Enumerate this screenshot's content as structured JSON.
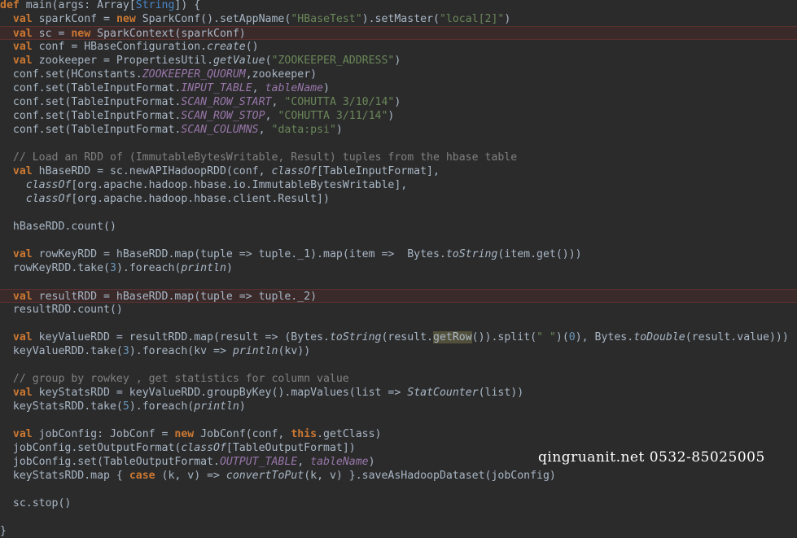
{
  "code_lines": [
    {
      "id": "l0",
      "indent": "",
      "parts": [
        [
          "kw",
          "def"
        ],
        [
          "p",
          " main(args: Array["
        ],
        [
          "ty",
          "String"
        ],
        [
          "p",
          "]) {"
        ]
      ]
    },
    {
      "id": "l1",
      "indent": "  ",
      "parts": [
        [
          "kw",
          "val"
        ],
        [
          "p",
          " sparkConf = "
        ],
        [
          "kw",
          "new"
        ],
        [
          "p",
          " SparkConf().setAppName("
        ],
        [
          "str",
          "\"HBaseTest\""
        ],
        [
          "p",
          ").setMaster("
        ],
        [
          "str",
          "\"local[2]\""
        ],
        [
          "p",
          ")"
        ]
      ]
    },
    {
      "id": "l2",
      "indent": "  ",
      "highlight": true,
      "parts": [
        [
          "kw",
          "val"
        ],
        [
          "p",
          " sc = "
        ],
        [
          "kw",
          "new"
        ],
        [
          "p",
          " SparkContext(sparkConf)"
        ]
      ]
    },
    {
      "id": "l3",
      "indent": "  ",
      "parts": [
        [
          "kw",
          "val"
        ],
        [
          "p",
          " conf = HBaseConfiguration."
        ],
        [
          "itm",
          "create"
        ],
        [
          "p",
          "()"
        ]
      ]
    },
    {
      "id": "l4",
      "indent": "  ",
      "parts": [
        [
          "kw",
          "val"
        ],
        [
          "p",
          " zookeeper = PropertiesUtil."
        ],
        [
          "itm",
          "getValue"
        ],
        [
          "p",
          "("
        ],
        [
          "str",
          "\"ZOOKEEPER_ADDRESS\""
        ],
        [
          "p",
          ")"
        ]
      ]
    },
    {
      "id": "l5",
      "indent": "  ",
      "parts": [
        [
          "p",
          "conf.set(HConstants."
        ],
        [
          "itf",
          "ZOOKEEPER_QUORUM"
        ],
        [
          "p",
          ",zookeeper)"
        ]
      ]
    },
    {
      "id": "l6",
      "indent": "  ",
      "parts": [
        [
          "p",
          "conf.set(TableInputFormat."
        ],
        [
          "itf",
          "INPUT_TABLE"
        ],
        [
          "p",
          ", "
        ],
        [
          "itf",
          "tableName"
        ],
        [
          "p",
          ")"
        ]
      ]
    },
    {
      "id": "l7",
      "indent": "  ",
      "parts": [
        [
          "p",
          "conf.set(TableInputFormat."
        ],
        [
          "itf",
          "SCAN_ROW_START"
        ],
        [
          "p",
          ", "
        ],
        [
          "str",
          "\"COHUTTA 3/10/14\""
        ],
        [
          "p",
          ")"
        ]
      ]
    },
    {
      "id": "l8",
      "indent": "  ",
      "parts": [
        [
          "p",
          "conf.set(TableInputFormat."
        ],
        [
          "itf",
          "SCAN_ROW_STOP"
        ],
        [
          "p",
          ", "
        ],
        [
          "str",
          "\"COHUTTA 3/11/14\""
        ],
        [
          "p",
          ")"
        ]
      ]
    },
    {
      "id": "l9",
      "indent": "  ",
      "parts": [
        [
          "p",
          "conf.set(TableInputFormat."
        ],
        [
          "itf",
          "SCAN_COLUMNS"
        ],
        [
          "p",
          ", "
        ],
        [
          "str",
          "\"data:psi\""
        ],
        [
          "p",
          ")"
        ]
      ]
    },
    {
      "id": "l10",
      "indent": "",
      "parts": []
    },
    {
      "id": "l11",
      "indent": "  ",
      "parts": [
        [
          "cmt",
          "// Load an RDD of (ImmutableBytesWritable, Result) tuples from the hbase table"
        ]
      ]
    },
    {
      "id": "l12",
      "indent": "  ",
      "parts": [
        [
          "kw",
          "val"
        ],
        [
          "p",
          " hBaseRDD = sc.newAPIHadoopRDD(conf, "
        ],
        [
          "itm",
          "classOf"
        ],
        [
          "p",
          "[TableInputFormat],"
        ]
      ]
    },
    {
      "id": "l13",
      "indent": "    ",
      "parts": [
        [
          "itm",
          "classOf"
        ],
        [
          "p",
          "[org.apache.hadoop.hbase.io.ImmutableBytesWritable],"
        ]
      ]
    },
    {
      "id": "l14",
      "indent": "    ",
      "parts": [
        [
          "itm",
          "classOf"
        ],
        [
          "p",
          "[org.apache.hadoop.hbase.client.Result])"
        ]
      ]
    },
    {
      "id": "l15",
      "indent": "",
      "parts": []
    },
    {
      "id": "l16",
      "indent": "  ",
      "parts": [
        [
          "p",
          "hBaseRDD.count()"
        ]
      ]
    },
    {
      "id": "l17",
      "indent": "",
      "parts": []
    },
    {
      "id": "l18",
      "indent": "  ",
      "parts": [
        [
          "kw",
          "val"
        ],
        [
          "p",
          " rowKeyRDD = hBaseRDD.map(tuple => tuple._1).map(item =>  Bytes."
        ],
        [
          "itm",
          "toString"
        ],
        [
          "p",
          "(item.get()))"
        ]
      ]
    },
    {
      "id": "l19",
      "indent": "  ",
      "parts": [
        [
          "p",
          "rowKeyRDD.take("
        ],
        [
          "num",
          "3"
        ],
        [
          "p",
          ")."
        ],
        [
          "p",
          "foreach"
        ],
        [
          "p",
          "("
        ],
        [
          "itm",
          "println"
        ],
        [
          "p",
          ")"
        ]
      ]
    },
    {
      "id": "l20",
      "indent": "",
      "parts": []
    },
    {
      "id": "l21",
      "indent": "  ",
      "highlight": true,
      "parts": [
        [
          "kw",
          "val"
        ],
        [
          "p",
          " resultRDD = hBaseRDD.map(tuple => tuple._2)"
        ]
      ]
    },
    {
      "id": "l22",
      "indent": "  ",
      "parts": [
        [
          "p",
          "resultRDD.count()"
        ]
      ]
    },
    {
      "id": "l23",
      "indent": "",
      "parts": []
    },
    {
      "id": "l24",
      "indent": "  ",
      "parts": [
        [
          "kw",
          "val"
        ],
        [
          "p",
          " keyValueRDD = resultRDD.map(result => (Bytes."
        ],
        [
          "itm",
          "toString"
        ],
        [
          "p",
          "(result."
        ],
        [
          "hlw",
          "getRow"
        ],
        [
          "p",
          "()).split("
        ],
        [
          "str",
          "\" \""
        ],
        [
          "p",
          ")("
        ],
        [
          "num",
          "0"
        ],
        [
          "p",
          "), Bytes."
        ],
        [
          "itm",
          "toDouble"
        ],
        [
          "p",
          "(result.value)))"
        ]
      ]
    },
    {
      "id": "l25",
      "indent": "  ",
      "parts": [
        [
          "p",
          "keyValueRDD.take("
        ],
        [
          "num",
          "3"
        ],
        [
          "p",
          ")."
        ],
        [
          "p",
          "foreach"
        ],
        [
          "p",
          "(kv => "
        ],
        [
          "itm",
          "println"
        ],
        [
          "p",
          "(kv))"
        ]
      ]
    },
    {
      "id": "l26",
      "indent": "",
      "parts": []
    },
    {
      "id": "l27",
      "indent": "  ",
      "parts": [
        [
          "cmt",
          "// group by rowkey , get statistics for column value"
        ]
      ]
    },
    {
      "id": "l28",
      "indent": "  ",
      "parts": [
        [
          "kw",
          "val"
        ],
        [
          "p",
          " keyStatsRDD = keyValueRDD."
        ],
        [
          "p",
          "groupByKey"
        ],
        [
          "p",
          "()."
        ],
        [
          "p",
          "mapValues"
        ],
        [
          "p",
          "(list => "
        ],
        [
          "itm",
          "StatCounter"
        ],
        [
          "p",
          "(list))"
        ]
      ]
    },
    {
      "id": "l29",
      "indent": "  ",
      "parts": [
        [
          "p",
          "keyStatsRDD.take("
        ],
        [
          "num",
          "5"
        ],
        [
          "p",
          ")."
        ],
        [
          "p",
          "foreach"
        ],
        [
          "p",
          "("
        ],
        [
          "itm",
          "println"
        ],
        [
          "p",
          ")"
        ]
      ]
    },
    {
      "id": "l30",
      "indent": "",
      "parts": []
    },
    {
      "id": "l31",
      "indent": "  ",
      "parts": [
        [
          "kw",
          "val"
        ],
        [
          "p",
          " jobConfig: JobConf = "
        ],
        [
          "kw",
          "new"
        ],
        [
          "p",
          " JobConf(conf, "
        ],
        [
          "kw",
          "this"
        ],
        [
          "p",
          ".getClass)"
        ]
      ]
    },
    {
      "id": "l32",
      "indent": "  ",
      "parts": [
        [
          "p",
          "jobConfig.setOutputFormat("
        ],
        [
          "itm",
          "classOf"
        ],
        [
          "p",
          "[TableOutputFormat])"
        ]
      ]
    },
    {
      "id": "l33",
      "indent": "  ",
      "parts": [
        [
          "p",
          "jobConfig.set(TableOutputFormat."
        ],
        [
          "itf",
          "OUTPUT_TABLE"
        ],
        [
          "p",
          ", "
        ],
        [
          "itf",
          "tableName"
        ],
        [
          "p",
          ")"
        ]
      ]
    },
    {
      "id": "l34",
      "indent": "  ",
      "parts": [
        [
          "p",
          "keyStatsRDD.map { "
        ],
        [
          "kw",
          "case"
        ],
        [
          "p",
          " (k, v) => "
        ],
        [
          "itm",
          "convertToPut"
        ],
        [
          "p",
          "(k, v) }."
        ],
        [
          "p",
          "saveAsHadoopDataset"
        ],
        [
          "p",
          "(jobConfig)"
        ]
      ]
    },
    {
      "id": "l35",
      "indent": "",
      "parts": []
    },
    {
      "id": "l36",
      "indent": "  ",
      "parts": [
        [
          "p",
          "sc.stop()"
        ]
      ]
    },
    {
      "id": "l37",
      "indent": "",
      "parts": []
    },
    {
      "id": "l38",
      "indent": "",
      "parts": [
        [
          "p",
          "}"
        ]
      ]
    }
  ],
  "watermark": "qingruanit.net 0532-85025005"
}
